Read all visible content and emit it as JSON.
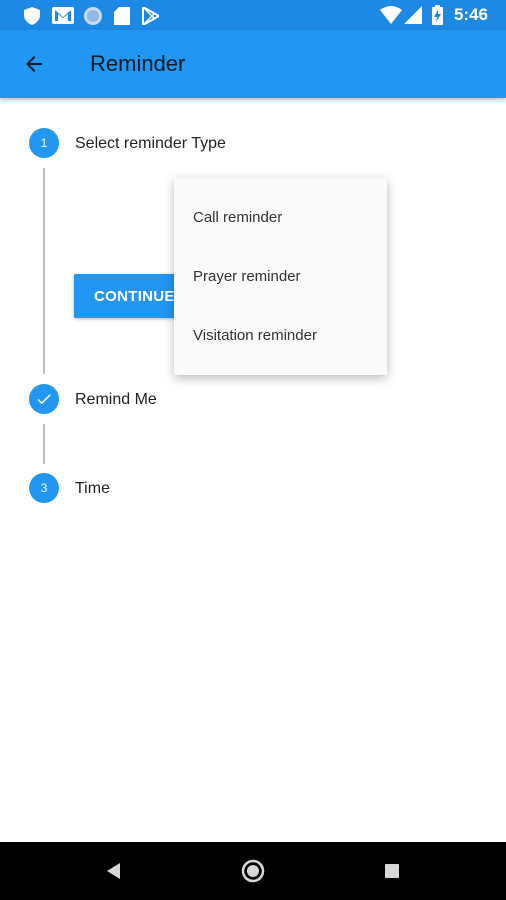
{
  "status_bar": {
    "time": "5:46",
    "left_icons": [
      "shield-icon",
      "gmail-icon",
      "circle-app-icon",
      "sd-card-icon",
      "play-store-icon"
    ],
    "right_icons": [
      "wifi-icon",
      "cell-signal-icon",
      "battery-charging-icon"
    ]
  },
  "app_bar": {
    "title": "Reminder",
    "back_icon": "arrow-back-icon",
    "color": "#2196f3"
  },
  "stepper": {
    "steps": [
      {
        "marker": "1",
        "label": "Select reminder Type",
        "state": "active"
      },
      {
        "marker": "check-icon",
        "label": "Remind Me",
        "state": "complete"
      },
      {
        "marker": "3",
        "label": "Time",
        "state": "pending"
      }
    ],
    "continue_label": "CONTINUE"
  },
  "dropdown_menu": {
    "items": [
      "Call reminder",
      "Prayer reminder",
      "Visitation reminder"
    ]
  },
  "nav_bar": {
    "buttons": [
      "back-triangle-icon",
      "home-circle-icon",
      "recents-square-icon"
    ]
  },
  "colors": {
    "accent": "#2196f3",
    "status_bar": "#1e88e5",
    "nav_bar": "#000000"
  }
}
